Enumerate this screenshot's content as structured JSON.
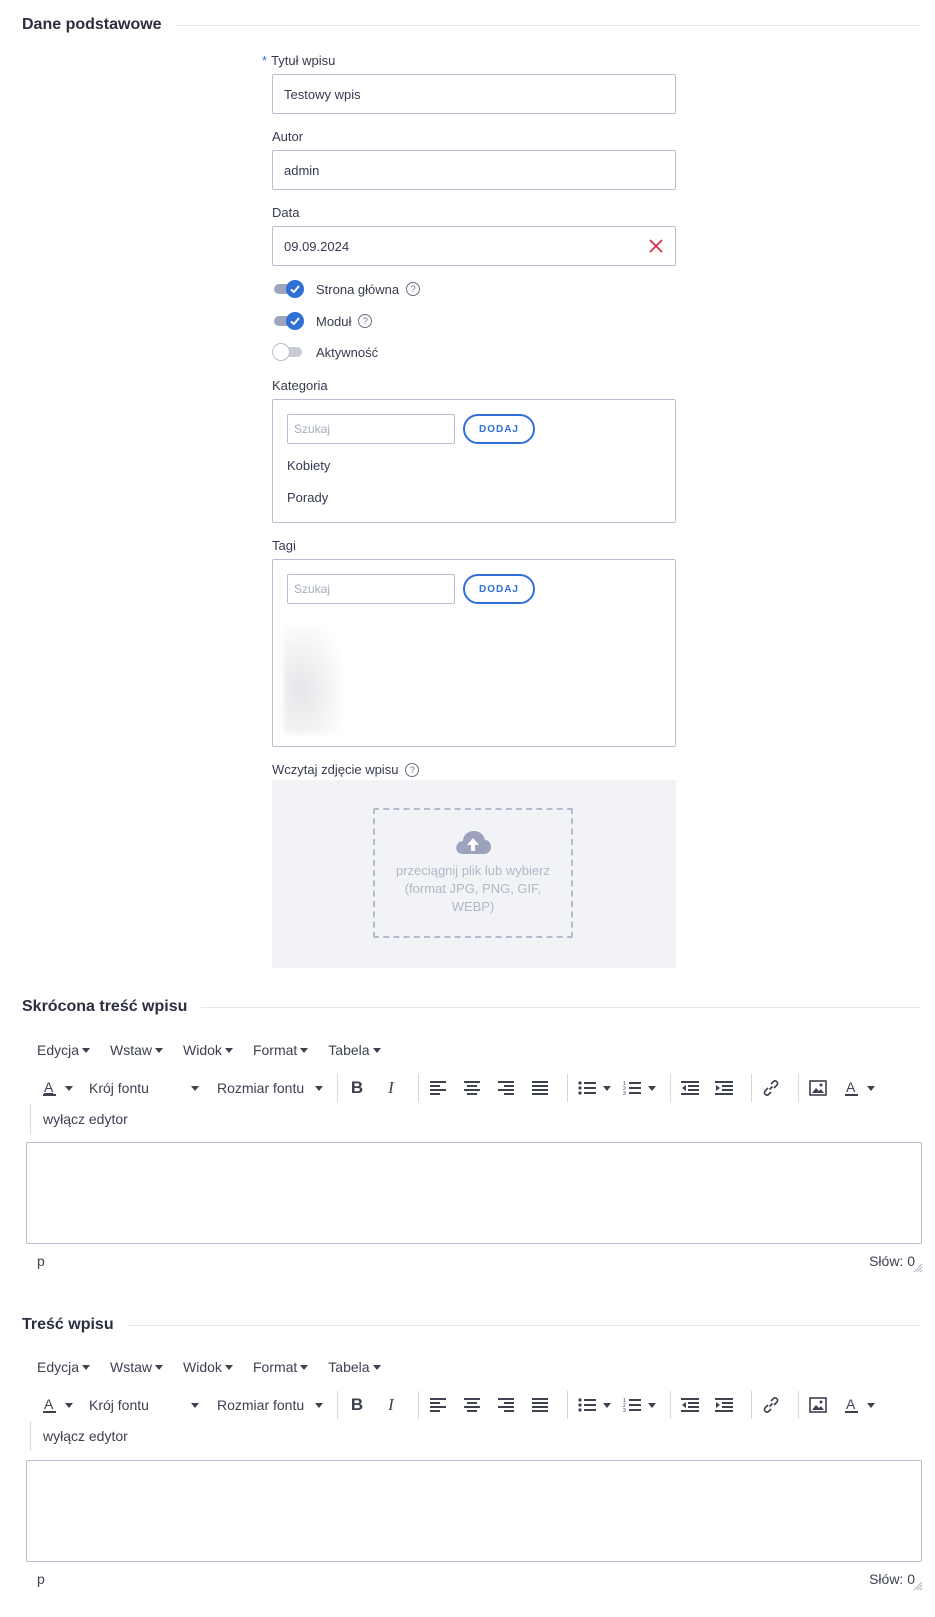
{
  "basic_section": {
    "title": "Dane podstawowe"
  },
  "post_title": {
    "required_mark": "*",
    "label": "Tytuł wpisu",
    "value": "Testowy wpis"
  },
  "author": {
    "label": "Autor",
    "value": "admin"
  },
  "date": {
    "label": "Data",
    "value": "09.09.2024"
  },
  "toggles": {
    "homepage": {
      "label": "Strona główna",
      "on": true
    },
    "module": {
      "label": "Moduł",
      "on": true
    },
    "active": {
      "label": "Aktywność",
      "on": false
    }
  },
  "category": {
    "label": "Kategoria",
    "search_placeholder": "Szukaj",
    "add_label": "DODAJ",
    "items": [
      "Kobiety",
      "Porady"
    ]
  },
  "tags": {
    "label": "Tagi",
    "search_placeholder": "Szukaj",
    "add_label": "DODAJ"
  },
  "upload": {
    "label": "Wczytaj zdjęcie wpisu",
    "dropzone_text": "przeciągnij plik lub wybierz (format JPG, PNG, GIF, WEBP)"
  },
  "short_content": {
    "title": "Skrócona treść wpisu",
    "menu": [
      "Edycja",
      "Wstaw",
      "Widok",
      "Format",
      "Tabela"
    ],
    "font_family": "Krój fontu",
    "font_size": "Rozmiar fontu",
    "toggle_editor": "wyłącz edytor",
    "status_path": "p",
    "word_count": "Słów: 0"
  },
  "content": {
    "title": "Treść wpisu",
    "menu": [
      "Edycja",
      "Wstaw",
      "Widok",
      "Format",
      "Tabela"
    ],
    "font_family": "Krój fontu",
    "font_size": "Rozmiar fontu",
    "toggle_editor": "wyłącz edytor",
    "status_path": "p",
    "word_count": "Słów: 0"
  },
  "colors": {
    "accent": "#2f6fd6",
    "clear": "#d9324a",
    "border": "#b9bfd0"
  }
}
